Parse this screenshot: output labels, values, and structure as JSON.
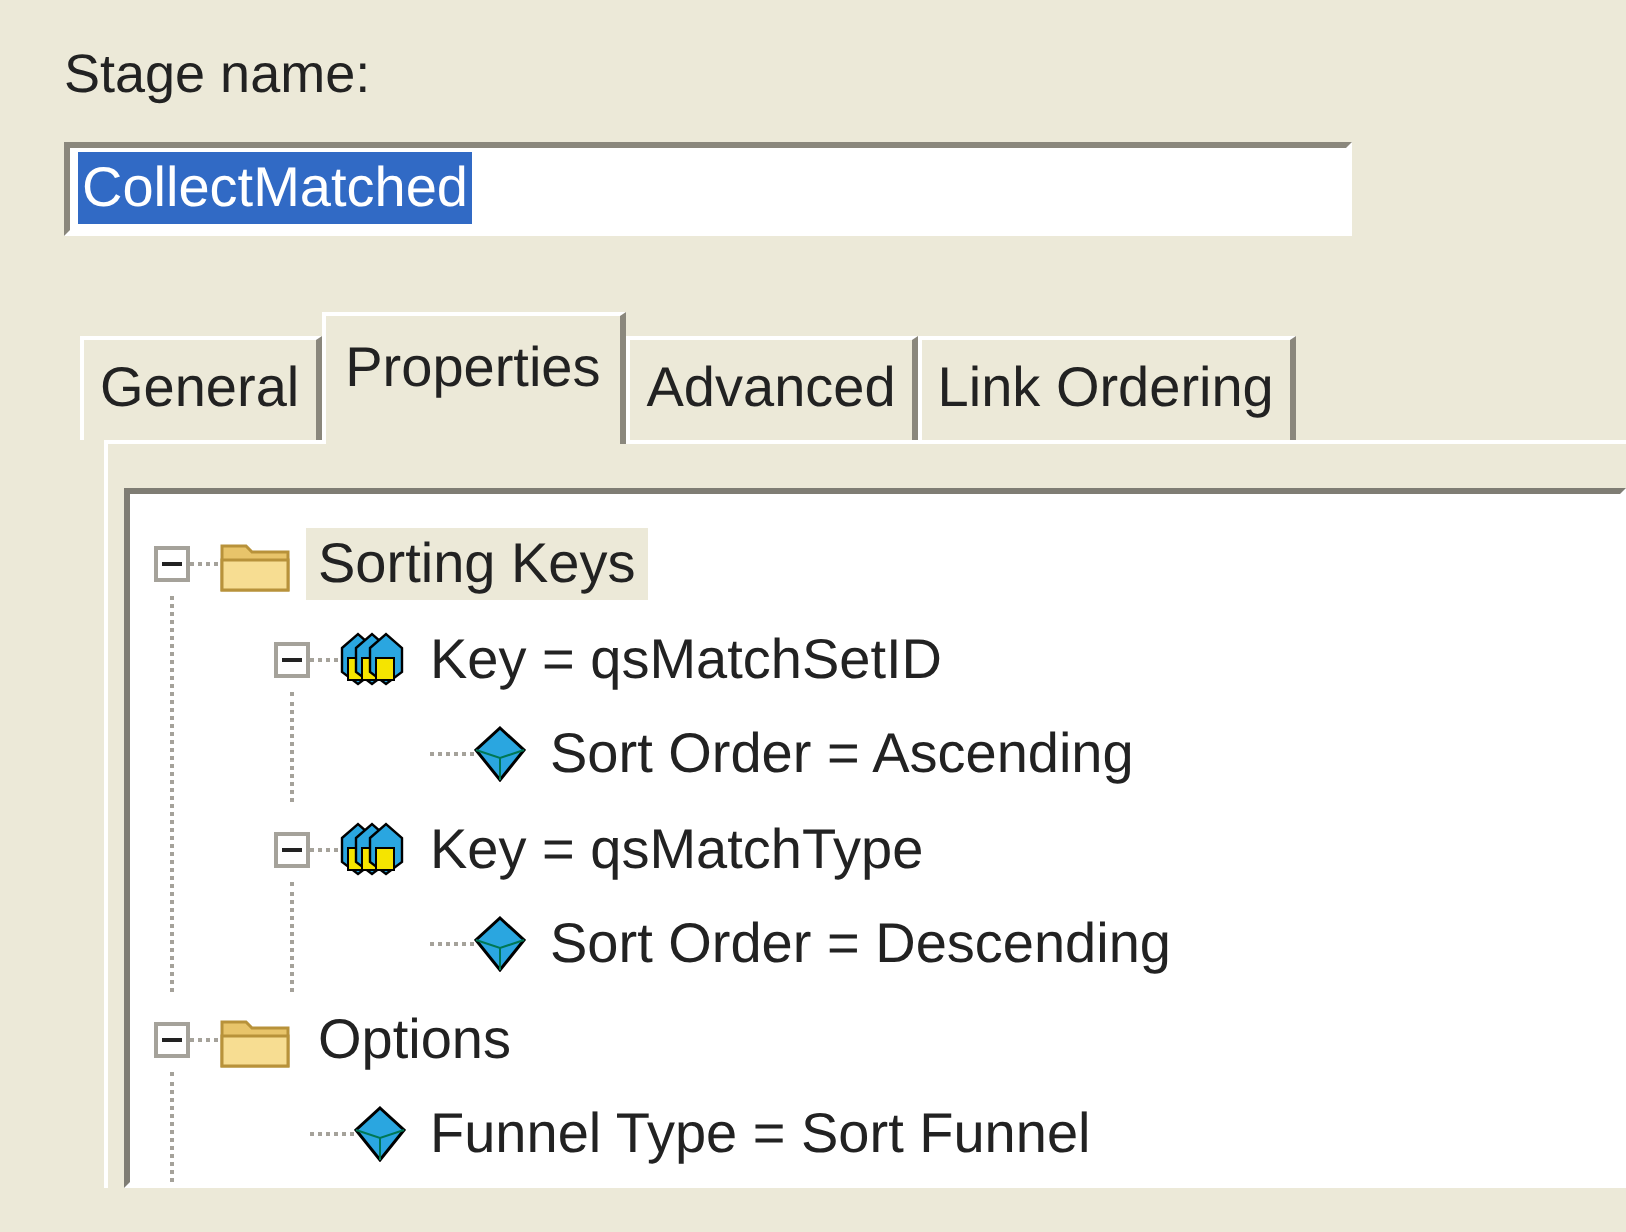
{
  "stage_name": {
    "label": "Stage name:",
    "value": "CollectMatched",
    "value_selected": true
  },
  "tabs": [
    {
      "label": "General",
      "selected": false
    },
    {
      "label": "Properties",
      "selected": true
    },
    {
      "label": "Advanced",
      "selected": false
    },
    {
      "label": "Link Ordering",
      "selected": false
    }
  ],
  "tree": [
    {
      "label": "Sorting Keys",
      "kind": "folder",
      "selected": true,
      "expanded": true,
      "children": [
        {
          "label": "Key = qsMatchSetID",
          "kind": "key",
          "selected": false,
          "expanded": true,
          "children": [
            {
              "label": "Sort Order = Ascending",
              "kind": "property",
              "selected": false
            }
          ]
        },
        {
          "label": "Key = qsMatchType",
          "kind": "key",
          "selected": false,
          "expanded": true,
          "children": [
            {
              "label": "Sort Order = Descending",
              "kind": "property",
              "selected": false
            }
          ]
        }
      ]
    },
    {
      "label": "Options",
      "kind": "folder",
      "selected": false,
      "expanded": true,
      "children": [
        {
          "label": "Funnel Type = Sort Funnel",
          "kind": "property",
          "selected": false
        }
      ]
    }
  ]
}
